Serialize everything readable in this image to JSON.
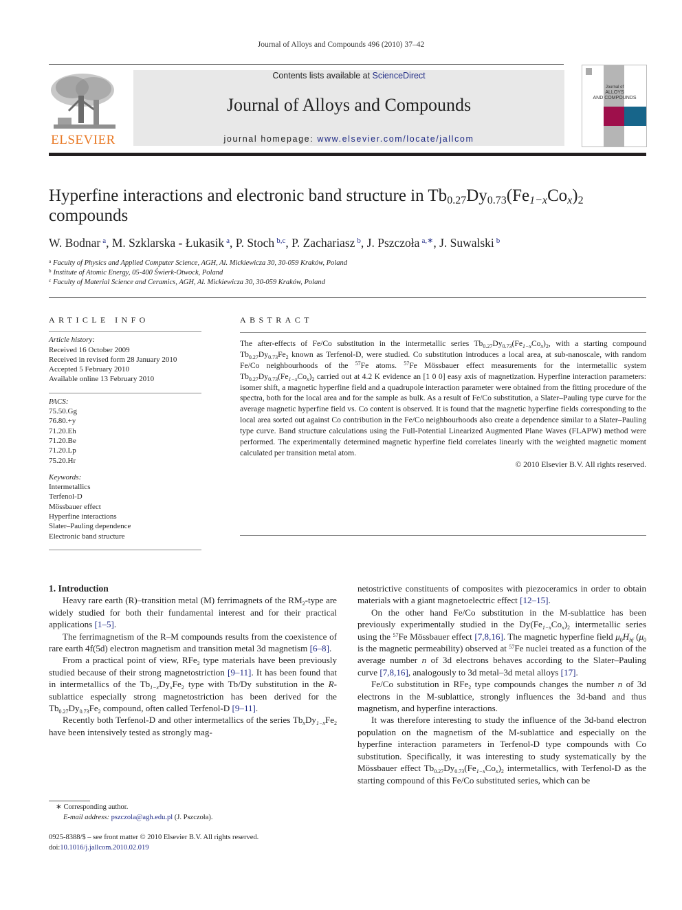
{
  "header": {
    "running_head": "Journal of Alloys and Compounds 496 (2010) 37–42",
    "publisher_logo_text": "ELSEVIER",
    "contents_prefix": "Contents lists available at ",
    "contents_link": "ScienceDirect",
    "journal_title": "Journal of Alloys and Compounds",
    "homepage_prefix": "journal homepage: ",
    "homepage_link": "www.elsevier.com/locate/jallcom",
    "cover": {
      "line1": "Journal of",
      "line2": "ALLOYS",
      "line3": "AND COMPOUNDS",
      "colors": {
        "gray": "#b5b5b5",
        "maroon": "#9e0f4b",
        "teal": "#17658a"
      }
    },
    "logo_color": "#e87722"
  },
  "article": {
    "title_part1": "Hyperfine interactions and electronic band structure in Tb",
    "title_sub1": "0.27",
    "title_part2": "Dy",
    "title_sub2": "0.73",
    "title_part3": "(Fe",
    "title_sub3": "1−x",
    "title_part4": "Co",
    "title_sub4": "x",
    "title_part5": ")",
    "title_sub5": "2",
    "title_line2": "compounds",
    "authors": [
      {
        "name": "W. Bodnar",
        "sup": "a",
        "sep": ", "
      },
      {
        "name": "M. Szklarska - Łukasik",
        "sup": "a",
        "sep": ", "
      },
      {
        "name": "P. Stoch",
        "sup": "b,c",
        "sep": ", "
      },
      {
        "name": "P. Zachariasz",
        "sup": "b",
        "sep": ", "
      },
      {
        "name": "J. Pszczoła",
        "sup": "a,∗",
        "sep": ", "
      },
      {
        "name": "J. Suwalski",
        "sup": "b",
        "sep": ""
      }
    ],
    "affiliations": [
      {
        "key": "a",
        "text": "Faculty of Physics and Applied Computer Science, AGH, Al. Mickiewicza 30, 30-059 Kraków, Poland"
      },
      {
        "key": "b",
        "text": "Institute of Atomic Energy, 05-400 Świerk-Otwock, Poland"
      },
      {
        "key": "c",
        "text": "Faculty of Material Science and Ceramics, AGH, Al. Mickiewicza 30, 30-059 Kraków, Poland"
      }
    ],
    "link_color": "#1f2a85"
  },
  "article_info": {
    "heading": "ARTICLE INFO",
    "history_label": "Article history:",
    "history": [
      "Received 16 October 2009",
      "Received in revised form 28 January 2010",
      "Accepted 5 February 2010",
      "Available online 13 February 2010"
    ],
    "pacs_label": "PACS:",
    "pacs": [
      "75.50.Gg",
      "76.80.+y",
      "71.20.Eh",
      "71.20.Be",
      "71.20.Lp",
      "75.20.Hr"
    ],
    "keywords_label": "Keywords:",
    "keywords": [
      "Intermetallics",
      "Terfenol-D",
      "Mössbauer effect",
      "Hyperfine interactions",
      "Slater–Pauling dependence",
      "Electronic band structure"
    ]
  },
  "abstract": {
    "heading": "ABSTRACT",
    "t1": "The after-effects of Fe/Co substitution in the intermetallic series Tb",
    "t2": "Dy",
    "t3": "(Fe",
    "t4": "Co",
    "t5": ")",
    "t6": ", with a starting compound Tb",
    "t7": "Dy",
    "t8": "Fe",
    "t9": " known as Terfenol-D, were studied. Co substitution introduces a local area, at sub-nanoscale, with random Fe/Co neighbourhoods of the ",
    "iso": "57",
    "t10": "Fe atoms. ",
    "t11": "Fe Mössbauer effect measurements for the intermetallic system Tb",
    "t12": "Dy",
    "t13": "(Fe",
    "t14": "Co",
    "t15": ")",
    "t16": " carried out at 4.2 K evidence an [1 0 0] easy axis of magnetization. Hyperfine interaction parameters: isomer shift, a magnetic hyperfine field and a quadrupole interaction parameter were obtained from the fitting procedure of the spectra, both for the local area and for the sample as bulk. As a result of Fe/Co substitution, a Slater–Pauling type curve for the average magnetic hyperfine field vs. Co content is observed. It is found that the magnetic hyperfine fields corresponding to the local area sorted out against Co contribution in the Fe/Co neighbourhoods also create a dependence similar to a Slater–Pauling type curve. Band structure calculations using the Full-Potential Linearized Augmented Plane Waves (FLAPW) method were performed. The experimentally determined magnetic hyperfine field correlates linearly with the weighted magnetic moment calculated per transition metal atom.",
    "sub_027": "0.27",
    "sub_073": "0.73",
    "sub_1mx": "1−x",
    "sub_x": "x",
    "sub_2": "2",
    "copyright": "© 2010 Elsevier B.V. All rights reserved."
  },
  "introduction": {
    "heading": "1.  Introduction",
    "p1_a": "Heavy rare earth (R)–transition metal (M) ferrimagnets of the RM",
    "p1_b": "-type are widely studied for both their fundamental interest and for their practical applications ",
    "p1_ref": "[1–5]",
    "p2_a": "The ferrimagnetism of the R–M compounds results from the coexistence of rare earth 4f(5d) electron magnetism and transition metal 3d magnetism ",
    "p2_ref": "[6–8]",
    "p3_a": "From a practical point of view, RFe",
    "p3_b": " type materials have been previously studied because of their strong magnetostriction ",
    "p3_ref1": "[9–11]",
    "p3_c": ". It has been found that in intermetallics of the Tb",
    "p3_d": "Dy",
    "p3_e": "Fe",
    "p3_f": " type with Tb/Dy substitution in the ",
    "p3_r": "R",
    "p3_g": "-sublattice especially strong magnetostriction has been derived for the Tb",
    "p3_h": "Dy",
    "p3_i": "Fe",
    "p3_j": " compound, often called Terfenol-D ",
    "p3_ref2": "[9–11]",
    "p4_a": "Recently both Terfenol-D and other intermetallics of the series Tb",
    "p4_b": "Dy",
    "p4_c": "Fe",
    "p4_d": " have been intensively tested as strongly magnetostrictive constituents of composites with piezoceramics in order to obtain materials with a giant magnetoelectric effect ",
    "p4_ref": "[12–15]",
    "p5_a": "On the other hand Fe/Co substitution in the M-sublattice has been previously experimentally studied in the Dy(Fe",
    "p5_b": "Co",
    "p5_c": ")",
    "p5_d": " intermetallic series using the ",
    "p5_e": "Fe Mössbauer effect ",
    "p5_ref1": "[7,8,16]",
    "p5_f": ". The magnetic hyperfine field ",
    "p5_mu": "μ",
    "p5_sub0": "0",
    "p5_H": "H",
    "p5_hf": "hf",
    "p5_g": " (",
    "p5_h": " is the magnetic permeability) observed at ",
    "p5_i": "Fe nuclei treated as a function of the average number ",
    "p5_n": "n",
    "p5_j": " of 3d electrons behaves according to the Slater–Pauling curve ",
    "p5_ref2": "[7,8,16]",
    "p5_k": ", analogously to 3d metal–3d metal alloys ",
    "p5_ref3": "[17]",
    "p6_a": "Fe/Co substitution in RFe",
    "p6_b": " type compounds changes the number ",
    "p6_n": "n",
    "p6_c": " of 3d electrons in the M-sublattice, strongly influences the 3d-band and thus magnetism, and hyperfine interactions.",
    "p7_a": "It was therefore interesting to study the influence of the 3d-band electron population on the magnetism of the M-sublattice and especially on the hyperfine interaction parameters in Terfenol-D type compounds with Co substitution. Specifically, it was interesting to study systematically by the Mössbauer effect Tb",
    "p7_b": "Dy",
    "p7_c": "(Fe",
    "p7_d": "Co",
    "p7_e": ")",
    "p7_f": " intermetallics, with Terfenol-D as the starting compound of this Fe/Co substituted series, which can be",
    "sub_1mx": "1−x",
    "sub_x": "x",
    "sub_2": "2",
    "sub_027": "0.27",
    "sub_073": "0.73",
    "iso": "57",
    "period": "."
  },
  "footnotes": {
    "star": "∗",
    "corresponding": " Corresponding author.",
    "email_label": "E-mail address: ",
    "email": "pszczola@agh.edu.pl",
    "email_suffix": " (J. Pszczoła).",
    "front_matter": "0925-8388/$ – see front matter © 2010 Elsevier B.V. All rights reserved.",
    "doi_prefix": "doi:",
    "doi": "10.1016/j.jallcom.2010.02.019"
  }
}
